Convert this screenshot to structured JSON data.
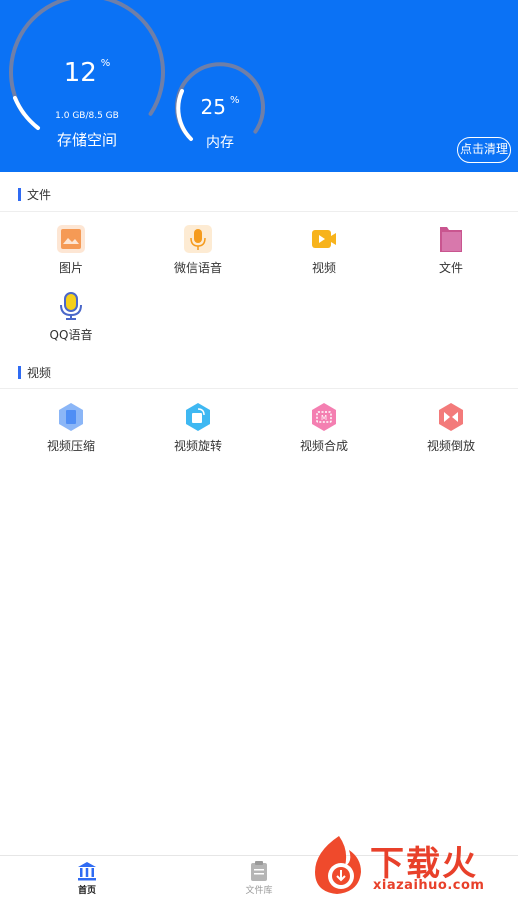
{
  "header": {
    "storage": {
      "percent": "12",
      "percent_sign": "%",
      "detail": "1.0 GB/8.5 GB",
      "label": "存储空间",
      "fraction": 0.12
    },
    "memory": {
      "percent": "25",
      "percent_sign": "%",
      "label": "内存",
      "fraction": 0.25
    },
    "clean_button": "点击清理"
  },
  "sections": {
    "files": {
      "title": "文件",
      "items": [
        {
          "label": "图片",
          "icon": "image-icon"
        },
        {
          "label": "微信语音",
          "icon": "microphone-icon"
        },
        {
          "label": "视频",
          "icon": "video-icon"
        },
        {
          "label": "文件",
          "icon": "folder-icon"
        },
        {
          "label": "QQ语音",
          "icon": "qq-microphone-icon"
        }
      ]
    },
    "video": {
      "title": "视频",
      "items": [
        {
          "label": "视频压缩",
          "icon": "compress-icon"
        },
        {
          "label": "视频旋转",
          "icon": "rotate-icon"
        },
        {
          "label": "视频合成",
          "icon": "merge-icon"
        },
        {
          "label": "视频倒放",
          "icon": "reverse-icon"
        }
      ]
    }
  },
  "bottom_nav": {
    "home": {
      "label": "首页",
      "icon": "bank-icon"
    },
    "library": {
      "label": "文件库",
      "icon": "clipboard-icon"
    }
  },
  "watermark": {
    "title": "下载火",
    "site": "xiazaihuo.com"
  },
  "colors": {
    "header": "#0b72f5",
    "accent": "#2f6bf3",
    "nav_active": "#1a1a1a",
    "nav_inactive": "#9a9a9a"
  }
}
